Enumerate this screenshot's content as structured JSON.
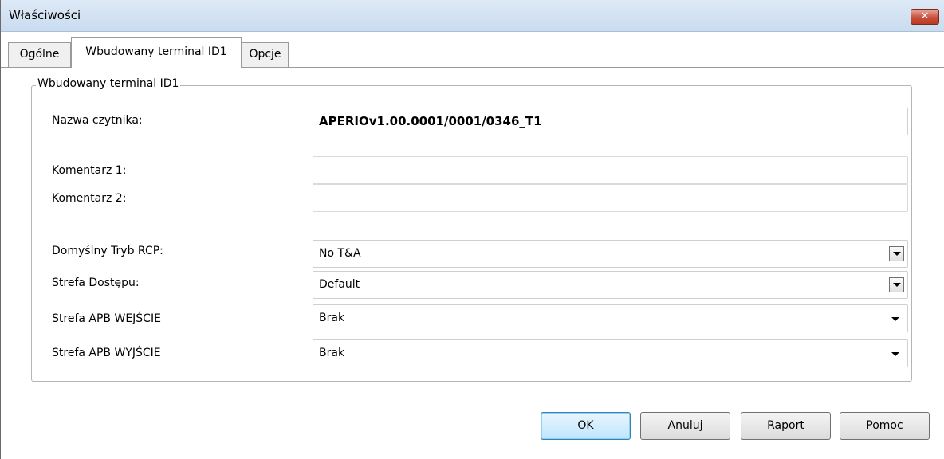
{
  "window": {
    "title": "Właściwości",
    "close_label": "✕"
  },
  "tabs": [
    {
      "label": "Ogólne"
    },
    {
      "label": "Wbudowany terminal ID1"
    },
    {
      "label": "Opcje"
    }
  ],
  "group": {
    "legend": "Wbudowany terminal ID1",
    "fields": {
      "reader_name": {
        "label": "Nazwa czytnika:",
        "value": "APERIOv1.00.0001/0001/0346_T1"
      },
      "comment1": {
        "label": "Komentarz 1:",
        "value": ""
      },
      "comment2": {
        "label": "Komentarz 2:",
        "value": ""
      },
      "rcp_mode": {
        "label": "Domyślny Tryb RCP:",
        "value": "No T&A"
      },
      "access_zone": {
        "label": "Strefa Dostępu:",
        "value": "Default"
      },
      "apb_in": {
        "label": "Strefa APB WEJŚCIE",
        "value": "Brak"
      },
      "apb_out": {
        "label": "Strefa APB WYJŚCIE",
        "value": "Brak"
      }
    }
  },
  "buttons": {
    "ok": "OK",
    "cancel": "Anuluj",
    "report": "Raport",
    "help": "Pomoc"
  }
}
